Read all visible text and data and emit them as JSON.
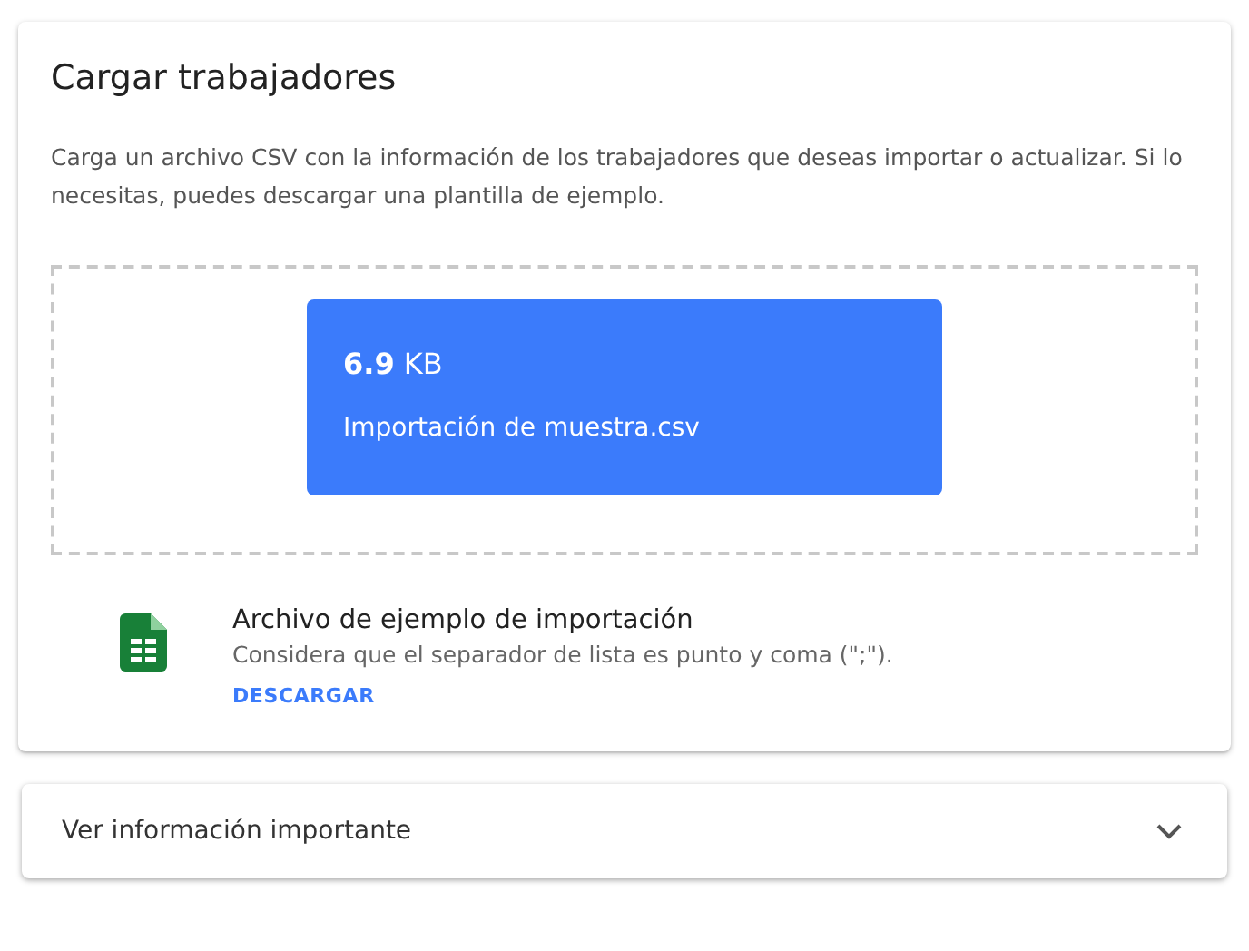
{
  "upload_card": {
    "title": "Cargar trabajadores",
    "description": "Carga un archivo CSV con la información de los trabajadores que deseas importar o actualizar. Si lo necesitas, puedes descargar una plantilla de ejemplo.",
    "file": {
      "size": "**6.9** KB",
      "name": "Importación de muestra.csv"
    },
    "sample": {
      "title": "Archivo de ejemplo de importación",
      "note": "Considera que el separador de lista es punto y coma (\";\").",
      "action": "DESCARGAR"
    }
  },
  "accordion": {
    "label": "Ver información importante",
    "expanded": false
  }
}
